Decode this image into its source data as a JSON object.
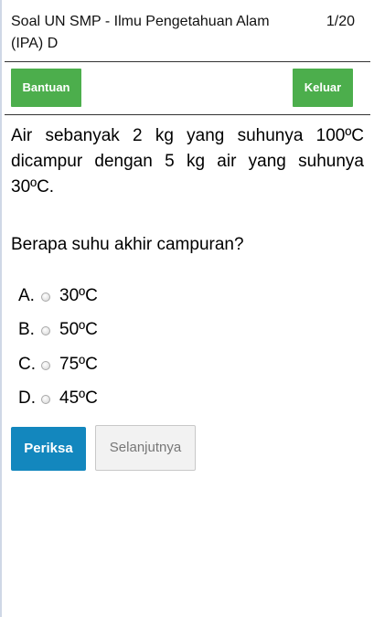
{
  "header": {
    "title": "Soal UN SMP - Ilmu Pengetahuan Alam (IPA) D",
    "counter": "1/20"
  },
  "toolbar": {
    "help_label": "Bantuan",
    "exit_label": "Keluar"
  },
  "question": {
    "text": "Air sebanyak 2 kg yang suhunya 100ºC dicampur dengan 5 kg air yang suhunya 30ºC.",
    "prompt": "Berapa suhu akhir campuran?"
  },
  "options": [
    {
      "letter": "A.",
      "value": "30ºC"
    },
    {
      "letter": "B.",
      "value": "50ºC"
    },
    {
      "letter": "C.",
      "value": "75ºC"
    },
    {
      "letter": "D.",
      "value": "45ºC"
    }
  ],
  "actions": {
    "check_label": "Periksa",
    "next_label": "Selanjutnya"
  },
  "colors": {
    "green_button": "#4cae4c",
    "blue_button": "#1387be",
    "disabled_button": "#f2f2f2"
  }
}
